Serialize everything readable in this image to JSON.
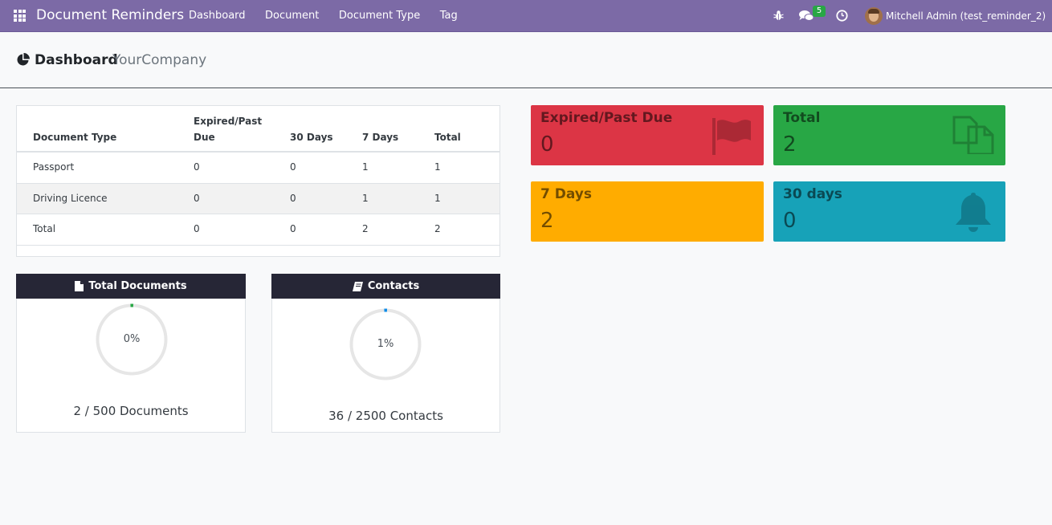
{
  "navbar": {
    "brand": "Document Reminders",
    "menu": [
      "Dashboard",
      "Document",
      "Document Type",
      "Tag"
    ],
    "chat_count": "5",
    "user": "Mitchell Admin (test_reminder_2)"
  },
  "control_panel": {
    "title": "Dashboard",
    "company": "YourCompany"
  },
  "table": {
    "headers": [
      "Document Type",
      "Expired/Past Due",
      "30 Days",
      "7 Days",
      "Total"
    ],
    "header_expired_line1": "Expired/Past",
    "header_expired_line2": "Due",
    "rows": [
      [
        "Passport",
        "0",
        "0",
        "1",
        "1"
      ],
      [
        "Driving Licence",
        "0",
        "0",
        "1",
        "1"
      ],
      [
        "Total",
        "0",
        "0",
        "2",
        "2"
      ]
    ]
  },
  "tiles": {
    "expired": {
      "label": "Expired/Past Due",
      "value": "0",
      "icon": "flag-icon",
      "color": "#dc3545"
    },
    "total": {
      "label": "Total",
      "value": "2",
      "icon": "copy-icon",
      "color": "#28a745"
    },
    "seven_days": {
      "label": "7 Days",
      "value": "2",
      "icon": "",
      "color": "#ffac00"
    },
    "thirty_days": {
      "label": "30 days",
      "value": "0",
      "icon": "bell-icon",
      "color": "#17a2b8"
    }
  },
  "cards": {
    "documents": {
      "title": "Total Documents",
      "icon": "file-icon",
      "percent_label": "0%",
      "progress_fraction": 0.004,
      "count_label": "2 / 500 Documents",
      "accent": "#28a745"
    },
    "contacts": {
      "title": "Contacts",
      "icon": "book-icon",
      "percent_label": "1%",
      "progress_fraction": 0.0144,
      "count_label": "36 / 2500 Contacts",
      "accent": "#0d8be8"
    }
  }
}
